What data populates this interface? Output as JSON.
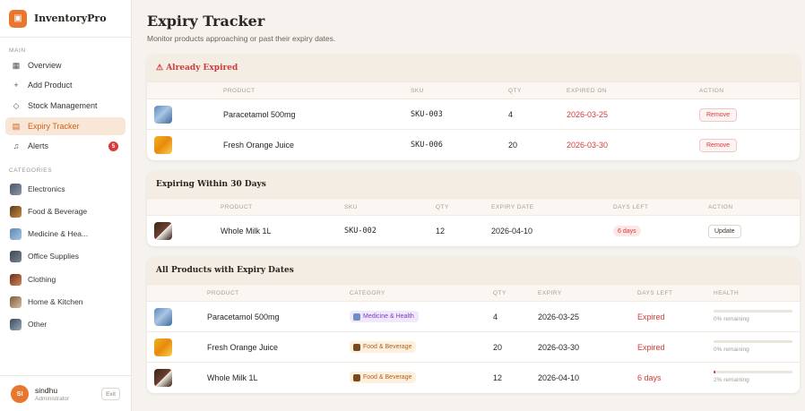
{
  "app": {
    "name": "InventoryPro"
  },
  "sidebar": {
    "main_label": "MAIN",
    "nav": [
      {
        "label": "Overview",
        "icon": "grid-icon"
      },
      {
        "label": "Add Product",
        "icon": "plus-icon"
      },
      {
        "label": "Stock Management",
        "icon": "tag-icon"
      },
      {
        "label": "Expiry Tracker",
        "icon": "calendar-icon",
        "active": true
      },
      {
        "label": "Alerts",
        "icon": "bell-icon",
        "badge": "5"
      }
    ],
    "categories_label": "CATEGORIES",
    "categories": [
      {
        "label": "Electronics"
      },
      {
        "label": "Food & Beverage"
      },
      {
        "label": "Medicine & Hea..."
      },
      {
        "label": "Office Supplies"
      },
      {
        "label": "Clothing"
      },
      {
        "label": "Home & Kitchen"
      },
      {
        "label": "Other"
      }
    ],
    "user": {
      "initials": "SI",
      "name": "sindhu",
      "role": "Administrator",
      "exit": "Exit"
    }
  },
  "page": {
    "title": "Expiry Tracker",
    "subtitle": "Monitor products approaching or past their expiry dates."
  },
  "expired": {
    "title": "⚠ Already Expired",
    "headers": [
      "PRODUCT",
      "SKU",
      "QTY",
      "EXPIRED ON",
      "ACTION"
    ],
    "rows": [
      {
        "product": "Paracetamol 500mg",
        "sku": "SKU-003",
        "qty": "4",
        "date": "2026-03-25",
        "action": "Remove"
      },
      {
        "product": "Fresh Orange Juice",
        "sku": "SKU-006",
        "qty": "20",
        "date": "2026-03-30",
        "action": "Remove"
      }
    ]
  },
  "expiring": {
    "title": "Expiring Within 30 Days",
    "headers": [
      "PRODUCT",
      "SKU",
      "QTY",
      "EXPIRY DATE",
      "DAYS LEFT",
      "ACTION"
    ],
    "rows": [
      {
        "product": "Whole Milk 1L",
        "sku": "SKU-002",
        "qty": "12",
        "date": "2026-04-10",
        "days": "6 days",
        "action": "Update"
      }
    ]
  },
  "all": {
    "title": "All Products with Expiry Dates",
    "headers": [
      "PRODUCT",
      "CATEGORY",
      "QTY",
      "EXPIRY",
      "DAYS LEFT",
      "HEALTH"
    ],
    "rows": [
      {
        "product": "Paracetamol 500mg",
        "category": "Medicine & Health",
        "qty": "4",
        "expiry": "2026-03-25",
        "days": "Expired",
        "health_pct": 0,
        "health_text": "0% remaining"
      },
      {
        "product": "Fresh Orange Juice",
        "category": "Food & Beverage",
        "qty": "20",
        "expiry": "2026-03-30",
        "days": "Expired",
        "health_pct": 0,
        "health_text": "0% remaining"
      },
      {
        "product": "Whole Milk 1L",
        "category": "Food & Beverage",
        "qty": "12",
        "expiry": "2026-04-10",
        "days": "6 days",
        "health_pct": 2,
        "health_text": "2% remaining"
      }
    ]
  },
  "colors": {
    "accent": "#e8762d",
    "danger": "#d23b3b",
    "background": "#f6f3ee"
  }
}
